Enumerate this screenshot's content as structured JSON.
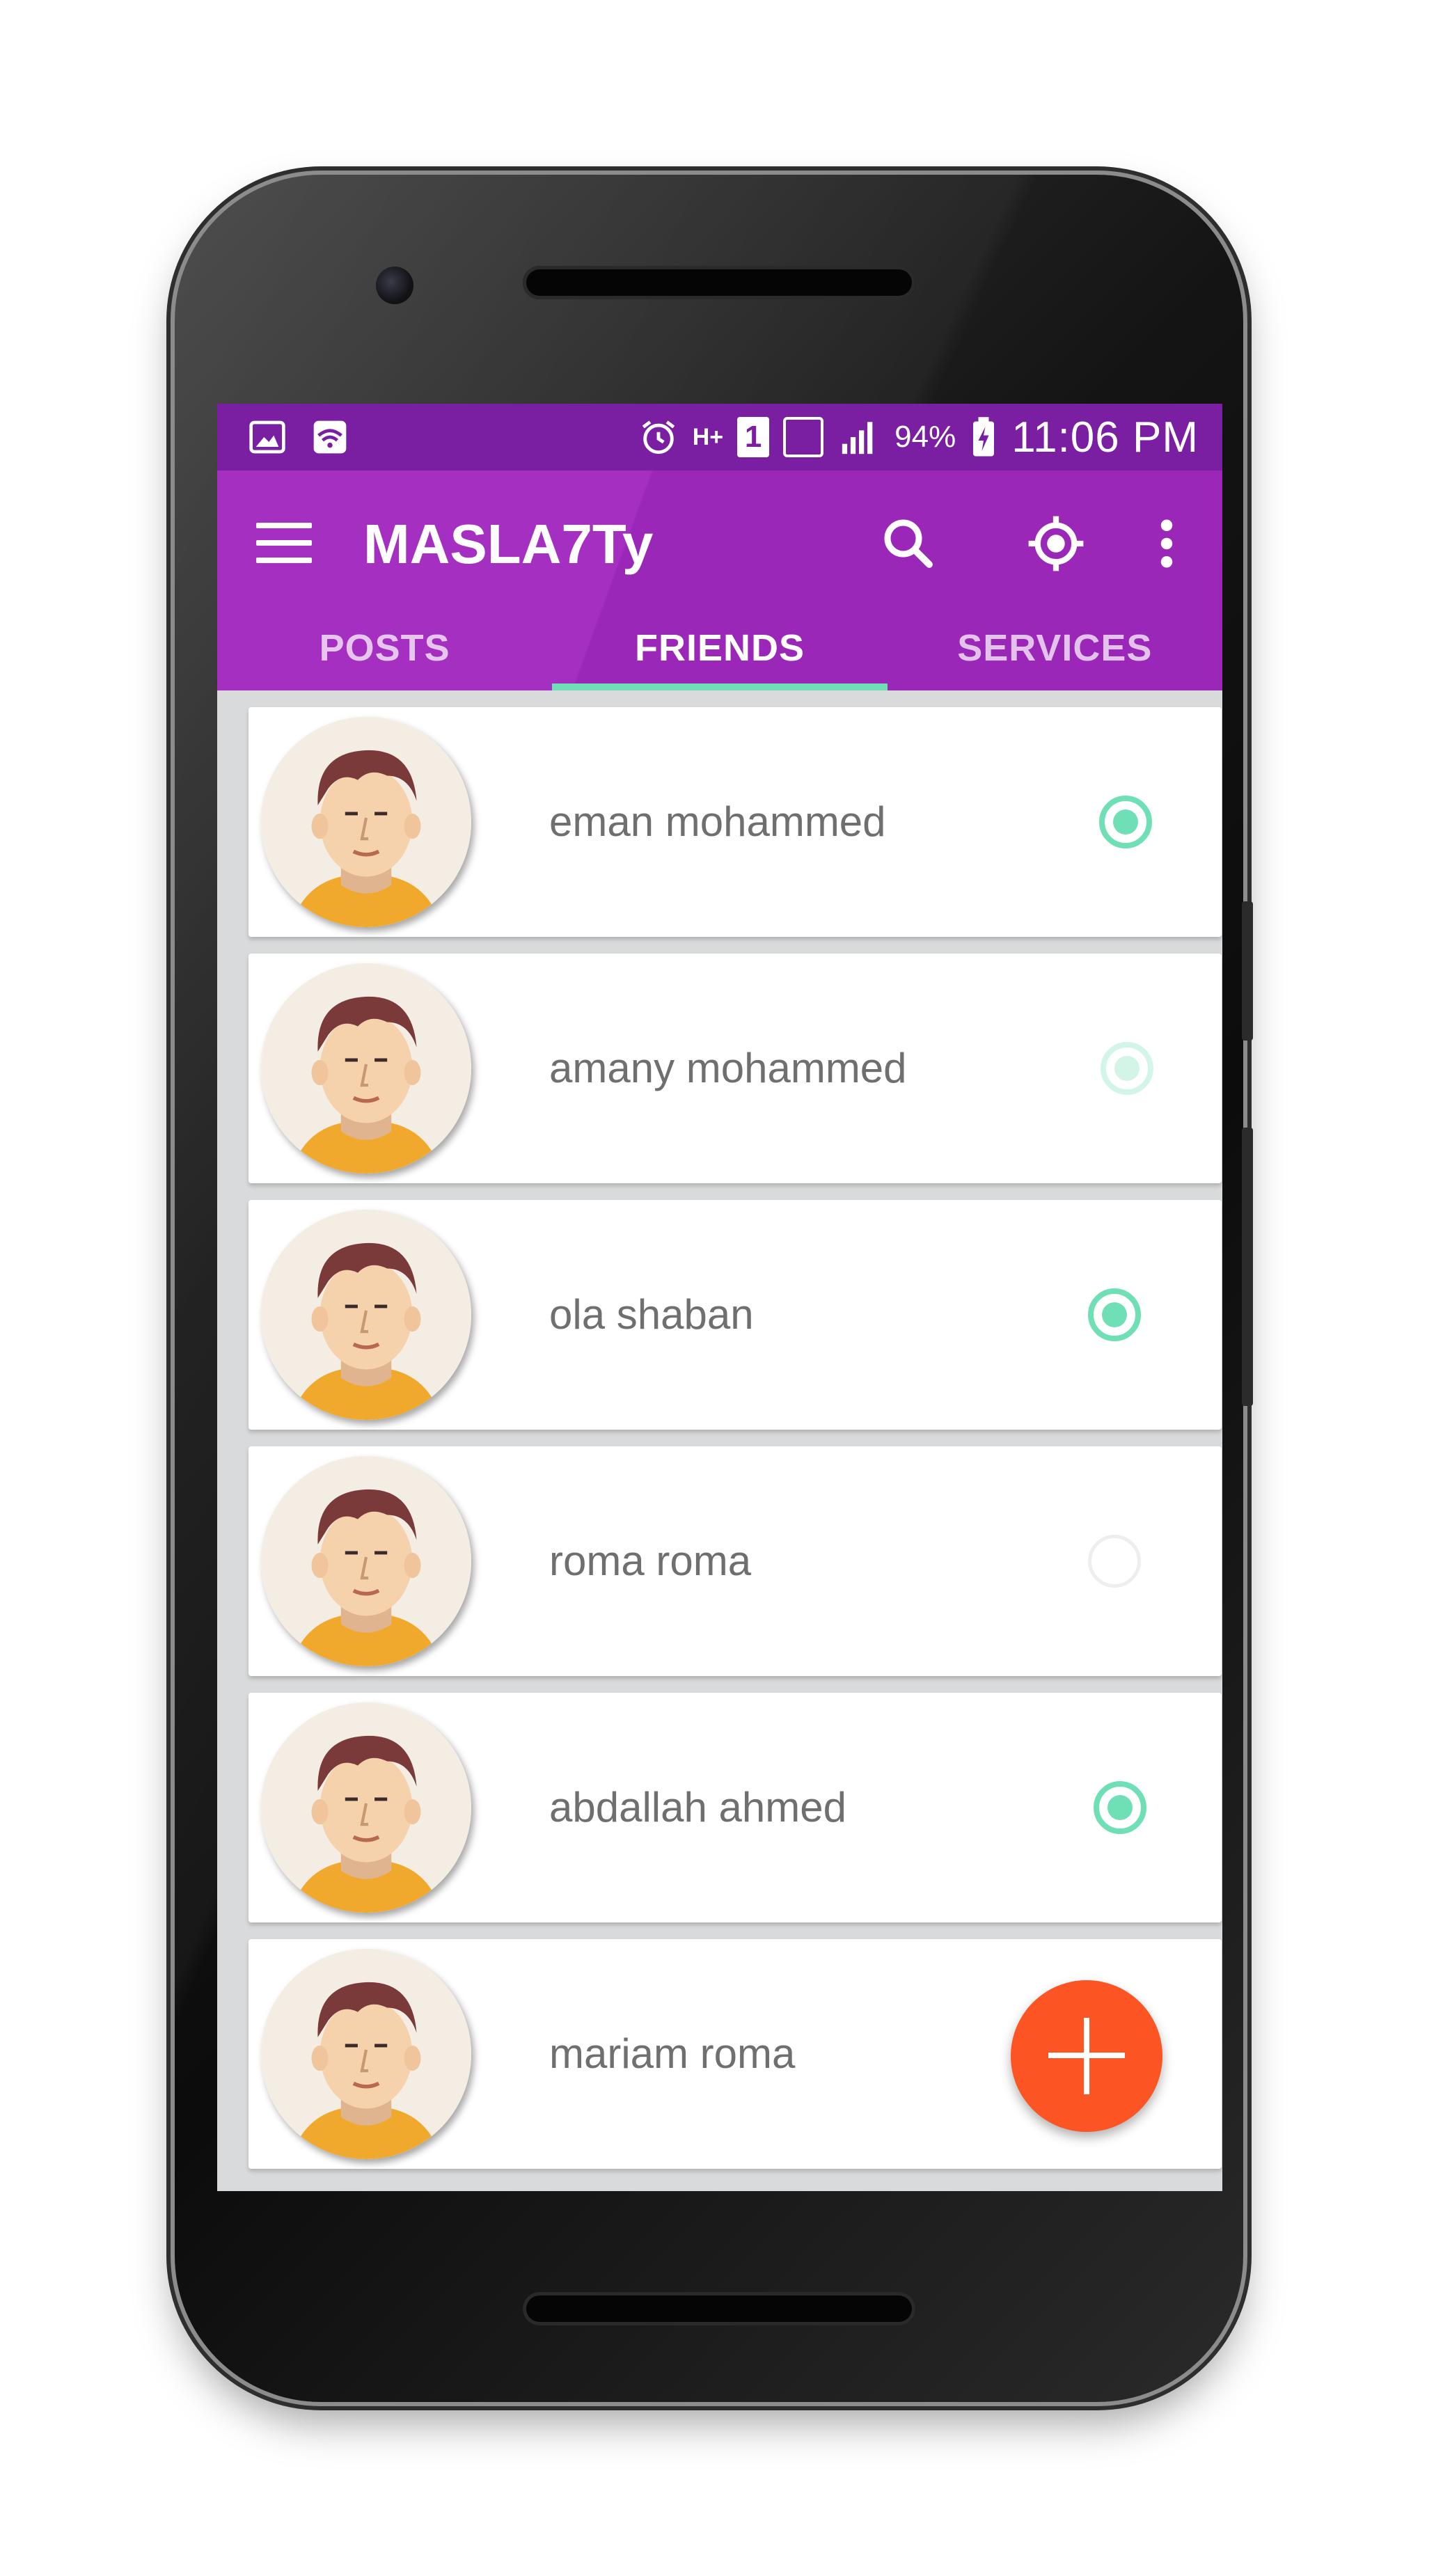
{
  "status_bar": {
    "left_icons": [
      "gallery-icon",
      "wifi-hotspot-icon"
    ],
    "right_icons": [
      "alarm-icon",
      "network-hplus-icon",
      "sim-1-icon",
      "signal-box-icon",
      "signal-icon"
    ],
    "network": "H+",
    "sim": "1",
    "battery_percent": "94%",
    "time": "11:06 PM"
  },
  "app_bar": {
    "title": "MASLA7Ty",
    "actions": [
      "search-icon",
      "locate-icon",
      "more-vert-icon"
    ],
    "background_color": "#9c27b0"
  },
  "tabs": [
    {
      "label": "POSTS",
      "active": false
    },
    {
      "label": "FRIENDS",
      "active": true
    },
    {
      "label": "SERVICES",
      "active": false
    }
  ],
  "friends": [
    {
      "name": "eman mohammed",
      "status": "selected"
    },
    {
      "name": "amany mohammed",
      "status": "faint"
    },
    {
      "name": "ola shaban",
      "status": "selected"
    },
    {
      "name": "roma roma",
      "status": "unselected"
    },
    {
      "name": "abdallah ahmed",
      "status": "selected"
    },
    {
      "name": "mariam roma",
      "status": "unselected"
    }
  ],
  "fab": {
    "icon": "plus-icon",
    "color": "#fc5523"
  },
  "accent_color": "#6fe0b5"
}
